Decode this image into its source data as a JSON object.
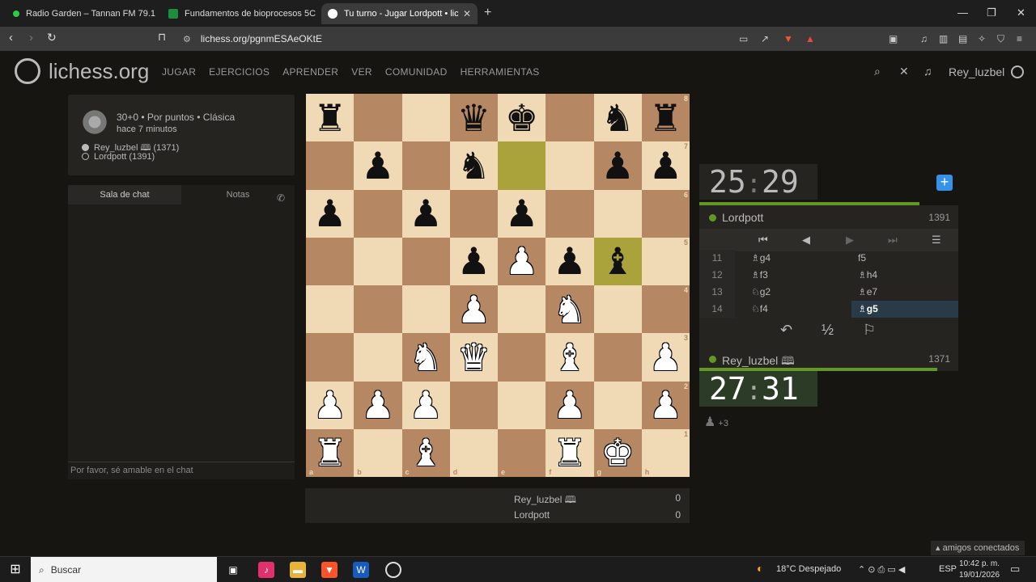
{
  "browser": {
    "tabs": [
      {
        "title": "Radio Garden – Tannan FM 79.1",
        "icon": "radio-garden-icon",
        "color": "#2ecc40"
      },
      {
        "title": "Fundamentos de bioprocesos 5C",
        "icon": "classroom-icon",
        "color": "#1e8e3e"
      },
      {
        "title": "Tu turno - Jugar Lordpott • liche",
        "icon": "lichess-icon",
        "color": "#ffffff"
      }
    ],
    "url": "lichess.org/pgnmESAeOKtE"
  },
  "site": {
    "logo_text": "lichess.org",
    "nav": [
      "JUGAR",
      "EJERCICIOS",
      "APRENDER",
      "VER",
      "COMUNIDAD",
      "HERRAMIENTAS"
    ],
    "username": "Rey_luzbel"
  },
  "game_meta": {
    "line1": "30+0 • Por puntos • Clásica",
    "line2": "hace 7 minutos",
    "white": "Rey_luzbel 🕮 (1371)",
    "black": "Lordpott (1391)"
  },
  "chat": {
    "tab_chat": "Sala de chat",
    "tab_notes": "Notas",
    "placeholder": "Por favor, sé amable en el chat"
  },
  "board": {
    "ranks": [
      "8",
      "7",
      "6",
      "5",
      "4",
      "3",
      "2",
      "1"
    ],
    "files": [
      "a",
      "b",
      "c",
      "d",
      "e",
      "f",
      "g",
      "h"
    ],
    "position": [
      [
        "♜",
        "",
        "",
        "♛",
        "♚",
        "",
        "♞",
        "♜"
      ],
      [
        "",
        "♟",
        "",
        "♞",
        "",
        "",
        "♟",
        "♟"
      ],
      [
        "♟",
        "",
        "♟",
        "",
        "♟",
        "",
        "",
        ""
      ],
      [
        "",
        "",
        "",
        "♟",
        "♙",
        "♟",
        "♝",
        ""
      ],
      [
        "",
        "",
        "",
        "♙",
        "",
        "♘",
        "",
        ""
      ],
      [
        "",
        "",
        "♘",
        "♕",
        "",
        "♗",
        "",
        "♙"
      ],
      [
        "♙",
        "♙",
        "♙",
        "",
        "",
        "♙",
        "",
        "♙"
      ],
      [
        "♖",
        "",
        "♗",
        "",
        "",
        "♖",
        "♔",
        ""
      ]
    ],
    "highlighted": [
      "e7",
      "g5"
    ]
  },
  "clocks": {
    "top": {
      "min": "25",
      "sec": "29"
    },
    "bottom": {
      "min": "27",
      "sec": "31"
    }
  },
  "players": {
    "top": {
      "name": "Lordpott",
      "rating": "1391"
    },
    "bottom": {
      "name": "Rey_luzbel 🕮",
      "rating": "1371"
    }
  },
  "moves": [
    {
      "num": "11",
      "white": "♗g4",
      "black": "f5"
    },
    {
      "num": "12",
      "white": "♗f3",
      "black": "♗h4"
    },
    {
      "num": "13",
      "white": "♘g2",
      "black": "♗e7"
    },
    {
      "num": "14",
      "white": "♘f4",
      "black": "♗g5"
    }
  ],
  "actions": {
    "draw": "½"
  },
  "material": "+3",
  "scores": [
    {
      "name": "Rey_luzbel 🕮",
      "score": "0"
    },
    {
      "name": "Lordpott",
      "score": "0"
    }
  ],
  "friends": "▴ amigos conectados",
  "taskbar": {
    "search": "Buscar",
    "weather": "18°C  Despejado",
    "lang": "ESP",
    "time": "10:42 p. m.",
    "date": "19/01/2026"
  }
}
